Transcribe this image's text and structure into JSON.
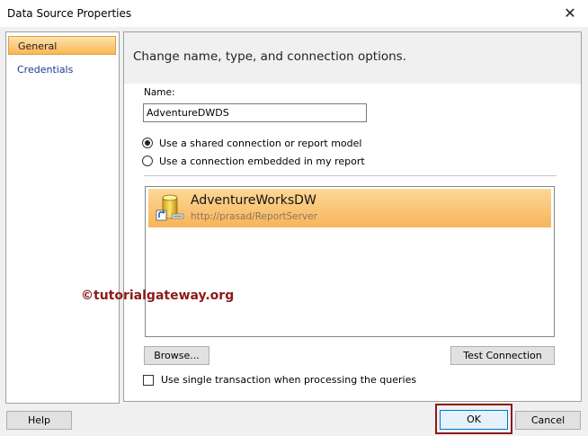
{
  "window": {
    "title": "Data Source Properties",
    "close_glyph": "✕"
  },
  "nav": {
    "items": [
      {
        "label": "General",
        "selected": true
      },
      {
        "label": "Credentials",
        "selected": false
      }
    ]
  },
  "header": {
    "text": "Change name, type, and connection options."
  },
  "name": {
    "label": "Name:",
    "value": "AdventureDWDS"
  },
  "radios": [
    {
      "label": "Use a shared connection or report model",
      "checked": true
    },
    {
      "label": "Use a connection embedded in my report",
      "checked": false
    }
  ],
  "datasources": [
    {
      "name": "AdventureWorksDW",
      "url": "http://prasad/ReportServer",
      "icon": "shared-datasource-icon"
    }
  ],
  "buttons": {
    "browse": "Browse...",
    "test": "Test Connection",
    "help": "Help",
    "ok": "OK",
    "cancel": "Cancel"
  },
  "transaction_checkbox": {
    "label": "Use single transaction when processing the queries",
    "checked": false
  },
  "watermark": "©tutorialgateway.org",
  "colors": {
    "selection": "#f8b45a",
    "highlight_border": "#8b1a1a",
    "watermark": "#8b1a1a"
  }
}
